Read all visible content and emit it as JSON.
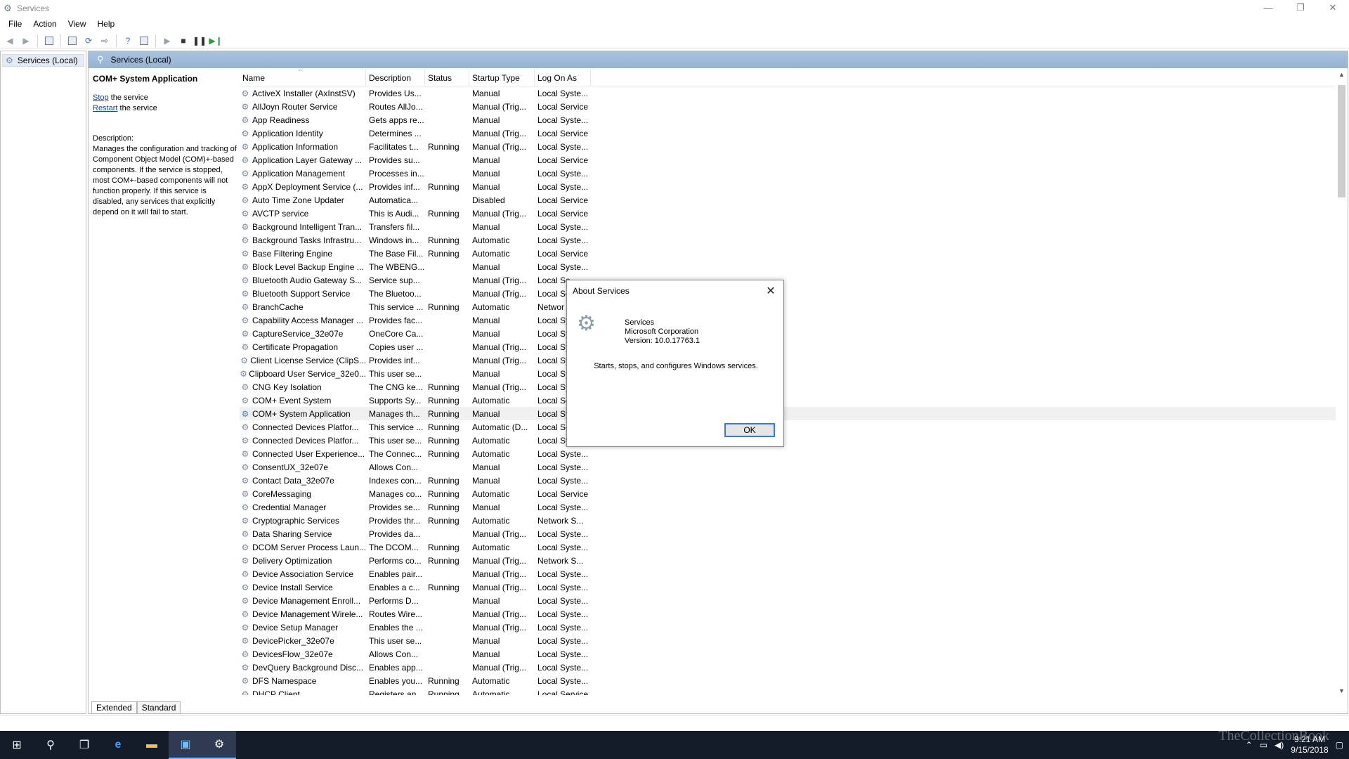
{
  "window": {
    "title": "Services"
  },
  "menu": [
    "File",
    "Action",
    "View",
    "Help"
  ],
  "tree": {
    "item": "Services (Local)"
  },
  "content_header": "Services (Local)",
  "left_pane": {
    "service_name": "COM+ System Application",
    "stop_link": "Stop",
    "stop_suffix": " the service",
    "restart_link": "Restart",
    "restart_suffix": " the service",
    "description_label": "Description:",
    "description": "Manages the configuration and tracking of Component Object Model (COM)+-based components. If the service is stopped, most COM+-based components will not function properly. If this service is disabled, any services that explicitly depend on it will fail to start."
  },
  "columns": [
    "Name",
    "Description",
    "Status",
    "Startup Type",
    "Log On As"
  ],
  "services": [
    [
      "ActiveX Installer (AxInstSV)",
      "Provides Us...",
      "",
      "Manual",
      "Local Syste..."
    ],
    [
      "AllJoyn Router Service",
      "Routes AllJo...",
      "",
      "Manual (Trig...",
      "Local Service"
    ],
    [
      "App Readiness",
      "Gets apps re...",
      "",
      "Manual",
      "Local Syste..."
    ],
    [
      "Application Identity",
      "Determines ...",
      "",
      "Manual (Trig...",
      "Local Service"
    ],
    [
      "Application Information",
      "Facilitates t...",
      "Running",
      "Manual (Trig...",
      "Local Syste..."
    ],
    [
      "Application Layer Gateway ...",
      "Provides su...",
      "",
      "Manual",
      "Local Service"
    ],
    [
      "Application Management",
      "Processes in...",
      "",
      "Manual",
      "Local Syste..."
    ],
    [
      "AppX Deployment Service (...",
      "Provides inf...",
      "Running",
      "Manual",
      "Local Syste..."
    ],
    [
      "Auto Time Zone Updater",
      "Automatica...",
      "",
      "Disabled",
      "Local Service"
    ],
    [
      "AVCTP service",
      "This is Audi...",
      "Running",
      "Manual (Trig...",
      "Local Service"
    ],
    [
      "Background Intelligent Tran...",
      "Transfers fil...",
      "",
      "Manual",
      "Local Syste..."
    ],
    [
      "Background Tasks Infrastru...",
      "Windows in...",
      "Running",
      "Automatic",
      "Local Syste..."
    ],
    [
      "Base Filtering Engine",
      "The Base Fil...",
      "Running",
      "Automatic",
      "Local Service"
    ],
    [
      "Block Level Backup Engine ...",
      "The WBENG...",
      "",
      "Manual",
      "Local Syste..."
    ],
    [
      "Bluetooth Audio Gateway S...",
      "Service sup...",
      "",
      "Manual (Trig...",
      "Local Se"
    ],
    [
      "Bluetooth Support Service",
      "The Bluetoo...",
      "",
      "Manual (Trig...",
      "Local Se"
    ],
    [
      "BranchCache",
      "This service ...",
      "Running",
      "Automatic",
      "Networ"
    ],
    [
      "Capability Access Manager ...",
      "Provides fac...",
      "",
      "Manual",
      "Local Sy"
    ],
    [
      "CaptureService_32e07e",
      "OneCore Ca...",
      "",
      "Manual",
      "Local Sy"
    ],
    [
      "Certificate Propagation",
      "Copies user ...",
      "",
      "Manual (Trig...",
      "Local Sy"
    ],
    [
      "Client License Service (ClipS...",
      "Provides inf...",
      "",
      "Manual (Trig...",
      "Local Sy"
    ],
    [
      "Clipboard User Service_32e0...",
      "This user se...",
      "",
      "Manual",
      "Local Sy"
    ],
    [
      "CNG Key Isolation",
      "The CNG ke...",
      "Running",
      "Manual (Trig...",
      "Local Sy"
    ],
    [
      "COM+ Event System",
      "Supports Sy...",
      "Running",
      "Automatic",
      "Local Se"
    ],
    [
      "COM+ System Application",
      "Manages th...",
      "Running",
      "Manual",
      "Local Sy"
    ],
    [
      "Connected Devices Platfor...",
      "This service ...",
      "Running",
      "Automatic (D...",
      "Local Se"
    ],
    [
      "Connected Devices Platfor...",
      "This user se...",
      "Running",
      "Automatic",
      "Local Sy"
    ],
    [
      "Connected User Experience...",
      "The Connec...",
      "Running",
      "Automatic",
      "Local Syste..."
    ],
    [
      "ConsentUX_32e07e",
      "Allows Con...",
      "",
      "Manual",
      "Local Syste..."
    ],
    [
      "Contact Data_32e07e",
      "Indexes con...",
      "Running",
      "Manual",
      "Local Syste..."
    ],
    [
      "CoreMessaging",
      "Manages co...",
      "Running",
      "Automatic",
      "Local Service"
    ],
    [
      "Credential Manager",
      "Provides se...",
      "Running",
      "Manual",
      "Local Syste..."
    ],
    [
      "Cryptographic Services",
      "Provides thr...",
      "Running",
      "Automatic",
      "Network S..."
    ],
    [
      "Data Sharing Service",
      "Provides da...",
      "",
      "Manual (Trig...",
      "Local Syste..."
    ],
    [
      "DCOM Server Process Laun...",
      "The DCOM...",
      "Running",
      "Automatic",
      "Local Syste..."
    ],
    [
      "Delivery Optimization",
      "Performs co...",
      "Running",
      "Manual (Trig...",
      "Network S..."
    ],
    [
      "Device Association Service",
      "Enables pair...",
      "",
      "Manual (Trig...",
      "Local Syste..."
    ],
    [
      "Device Install Service",
      "Enables a c...",
      "Running",
      "Manual (Trig...",
      "Local Syste..."
    ],
    [
      "Device Management Enroll...",
      "Performs D...",
      "",
      "Manual",
      "Local Syste..."
    ],
    [
      "Device Management Wirele...",
      "Routes Wire...",
      "",
      "Manual (Trig...",
      "Local Syste..."
    ],
    [
      "Device Setup Manager",
      "Enables the ...",
      "",
      "Manual (Trig...",
      "Local Syste..."
    ],
    [
      "DevicePicker_32e07e",
      "This user se...",
      "",
      "Manual",
      "Local Syste..."
    ],
    [
      "DevicesFlow_32e07e",
      "Allows Con...",
      "",
      "Manual",
      "Local Syste..."
    ],
    [
      "DevQuery Background Disc...",
      "Enables app...",
      "",
      "Manual (Trig...",
      "Local Syste..."
    ],
    [
      "DFS Namespace",
      "Enables you...",
      "Running",
      "Automatic",
      "Local Syste..."
    ],
    [
      "DHCP Client",
      "Registers an...",
      "Running",
      "Automatic",
      "Local Service"
    ]
  ],
  "selected_row": "COM+ System Application",
  "tabs": [
    "Extended",
    "Standard"
  ],
  "dialog": {
    "title": "About Services",
    "product": "Services",
    "company": "Microsoft Corporation",
    "version": "Version: 10.0.17763.1",
    "text": "Starts, stops, and configures Windows services.",
    "ok": "OK"
  },
  "tray": {
    "time": "9:21 AM",
    "date": "9/15/2018"
  },
  "watermark": "TheCollectionBook",
  "colors": {
    "header_bar": "#a9c2df",
    "taskbar": "#141c2a",
    "link": "#0645ad",
    "ok_border": "#3b7bd6"
  }
}
